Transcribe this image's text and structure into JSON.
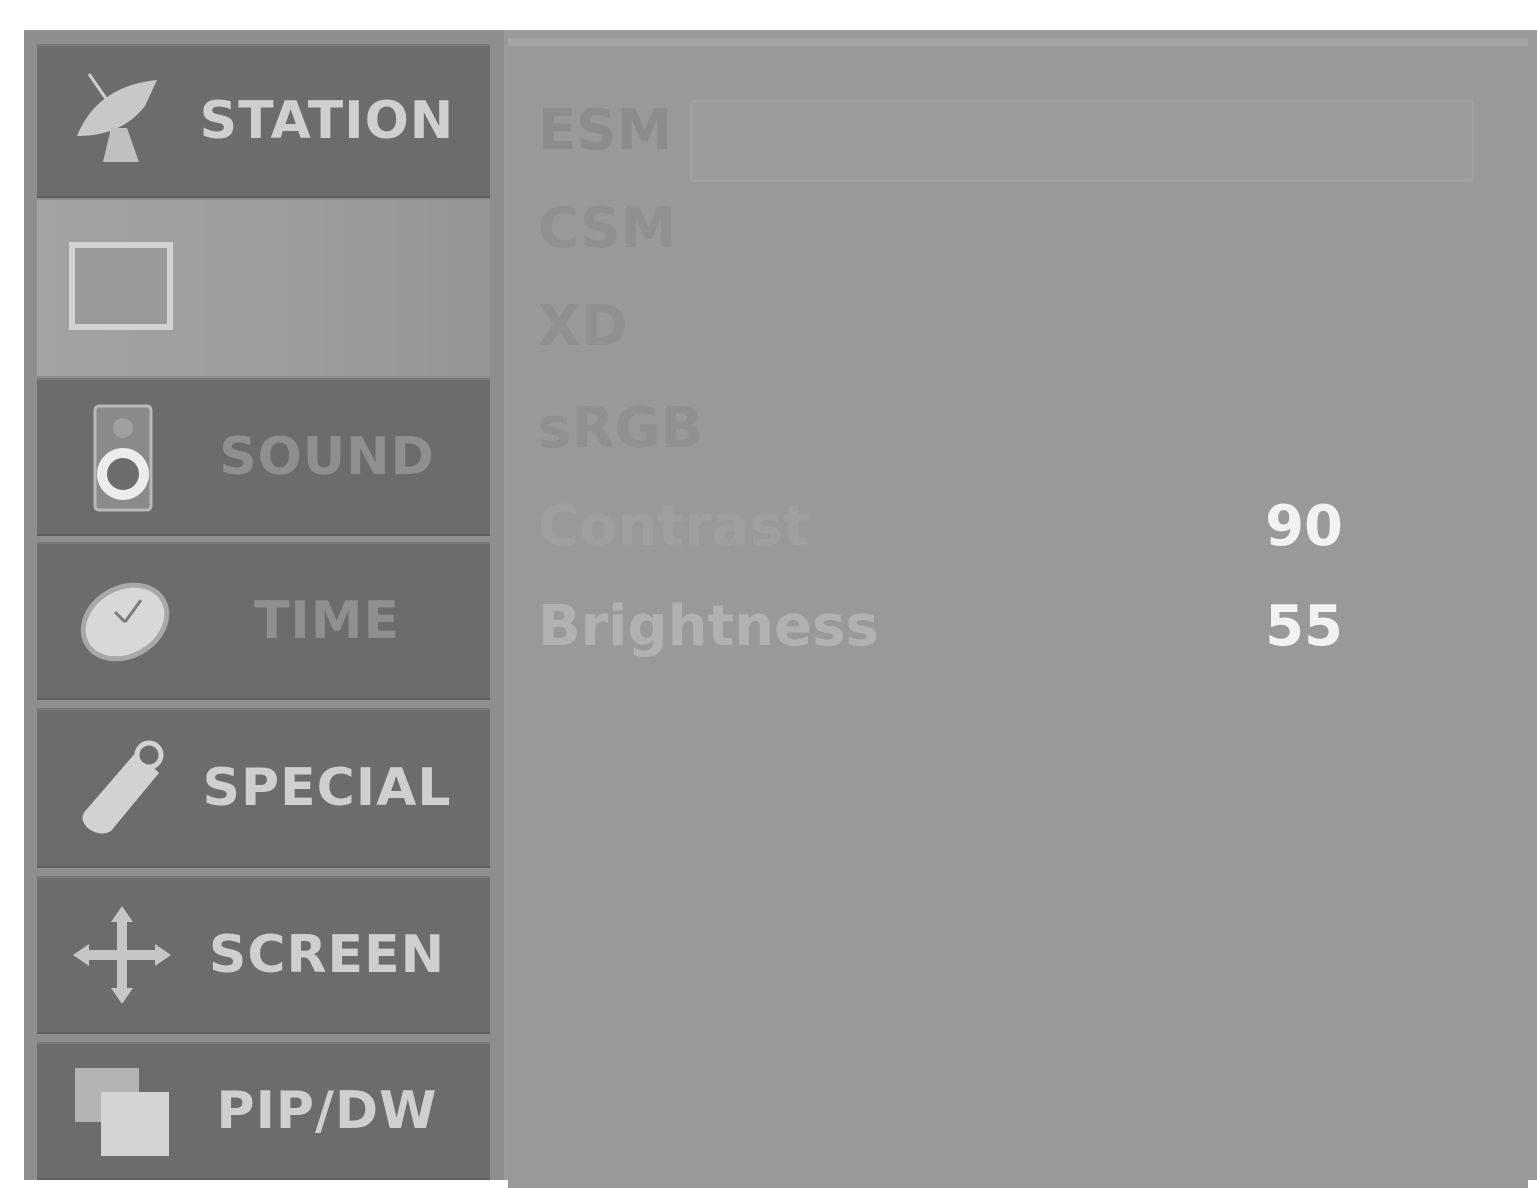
{
  "menu": {
    "items": [
      {
        "key": "station",
        "label": "STATION",
        "icon": "satellite-dish-icon"
      },
      {
        "key": "picture",
        "label": "",
        "icon": "picture-frame-icon",
        "selected": true
      },
      {
        "key": "sound",
        "label": "SOUND",
        "icon": "speaker-icon"
      },
      {
        "key": "time",
        "label": "TIME",
        "icon": "clock-icon"
      },
      {
        "key": "special",
        "label": "SPECIAL",
        "icon": "tag-icon"
      },
      {
        "key": "screen",
        "label": "SCREEN",
        "icon": "move-arrows-icon"
      },
      {
        "key": "pip",
        "label": "PIP/DW",
        "icon": "pip-windows-icon"
      }
    ]
  },
  "picture": {
    "rows": [
      {
        "label": "ESM",
        "value": ""
      },
      {
        "label": "CSM",
        "value": ""
      },
      {
        "label": "XD",
        "value": ""
      },
      {
        "label": "sRGB",
        "value": ""
      },
      {
        "label": "Contrast",
        "value": "90"
      },
      {
        "label": "Brightness",
        "value": "55"
      }
    ]
  }
}
